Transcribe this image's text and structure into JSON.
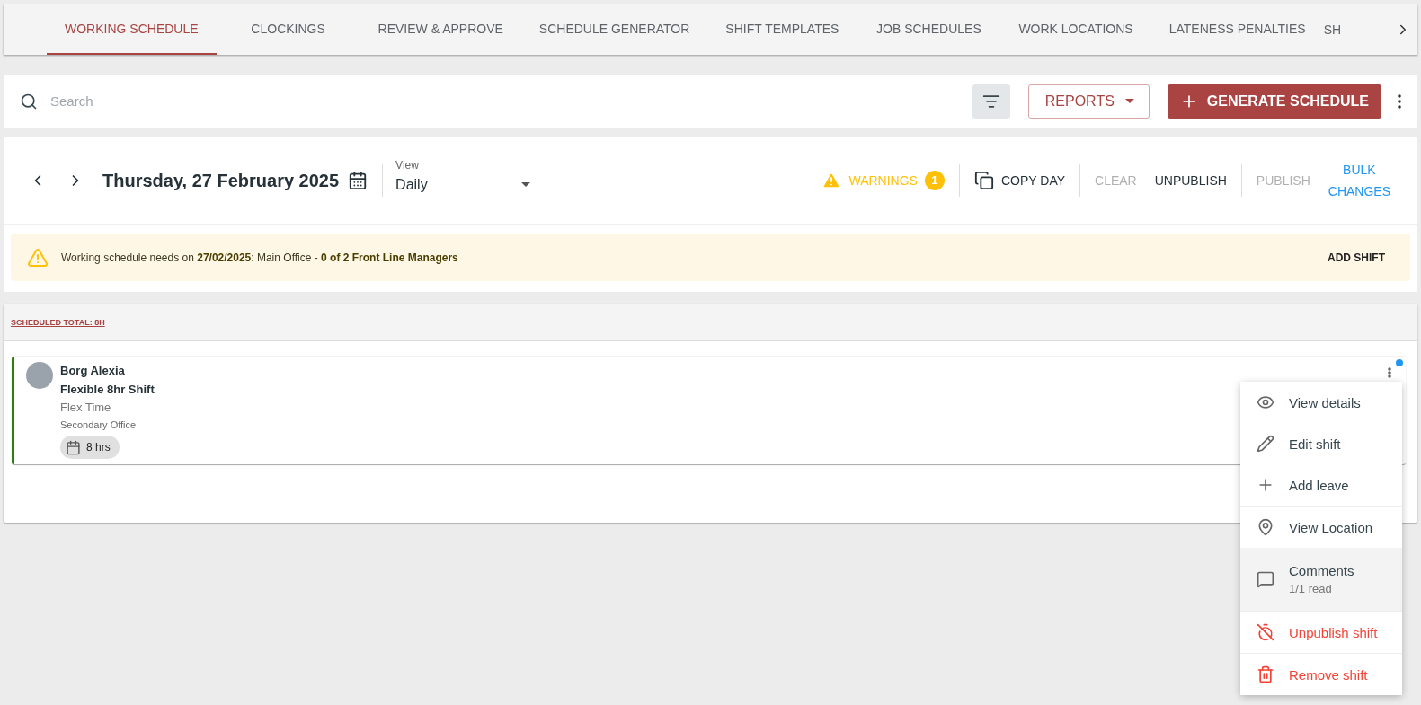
{
  "tabs": [
    {
      "label": "WORKING SCHEDULE",
      "selected": true
    },
    {
      "label": "CLOCKINGS",
      "selected": false
    },
    {
      "label": "REVIEW & APPROVE",
      "selected": false
    },
    {
      "label": "SCHEDULE GENERATOR",
      "selected": false
    },
    {
      "label": "SHIFT TEMPLATES",
      "selected": false
    },
    {
      "label": "JOB SCHEDULES",
      "selected": false
    },
    {
      "label": "WORK LOCATIONS",
      "selected": false
    },
    {
      "label": "LATENESS PENALTIES",
      "selected": false
    },
    {
      "label": "SH",
      "selected": false
    }
  ],
  "search": {
    "placeholder": "Search"
  },
  "reports_button": "REPORTS",
  "generate_button": "GENERATE SCHEDULE",
  "date": "Thursday, 27 February 2025",
  "view_select": {
    "label": "View",
    "value": "Daily"
  },
  "actions": [
    {
      "kind": "warnings",
      "label": "WARNINGS",
      "count": "1",
      "disabled": false,
      "separator_after": true
    },
    {
      "kind": "copy",
      "label": "COPY DAY",
      "disabled": false,
      "separator_after": true
    },
    {
      "kind": "text",
      "label": "CLEAR",
      "disabled": true,
      "separator_after": false
    },
    {
      "kind": "text",
      "label": "UNPUBLISH",
      "disabled": false,
      "separator_after": true
    },
    {
      "kind": "text",
      "label": "PUBLISH",
      "disabled": true,
      "separator_after": false
    },
    {
      "kind": "link",
      "label": "BULK\nCHANGES",
      "disabled": false,
      "separator_after": false
    }
  ],
  "banner": {
    "message": "Working schedule needs on **27/02/2025**: Main Office - **0 of 2 Front Line Managers**",
    "action": "ADD SHIFT"
  },
  "scheduled_total": "SCHEDULED TOTAL: 8H",
  "shift": {
    "employee": "Borg Alexia",
    "shift_name": "Flexible 8hr Shift",
    "type": "Flex Time",
    "location": "Secondary Office",
    "hours": "8 hrs",
    "color": "#2e7d12",
    "unread": true
  },
  "menu": [
    [
      {
        "kind": "view",
        "label": "View details",
        "selected": false
      },
      {
        "kind": "edit",
        "label": "Edit shift",
        "selected": false
      },
      {
        "kind": "add",
        "label": "Add leave",
        "selected": false
      }
    ],
    [
      {
        "kind": "location",
        "label": "View Location",
        "selected": false
      },
      {
        "kind": "comments",
        "label": "Comments",
        "sub": "1/1 read",
        "selected": true
      }
    ],
    [
      {
        "kind": "unpublish",
        "label": "Unpublish shift",
        "selected": false
      }
    ],
    [
      {
        "kind": "remove",
        "label": "Remove shift",
        "selected": false
      }
    ]
  ]
}
